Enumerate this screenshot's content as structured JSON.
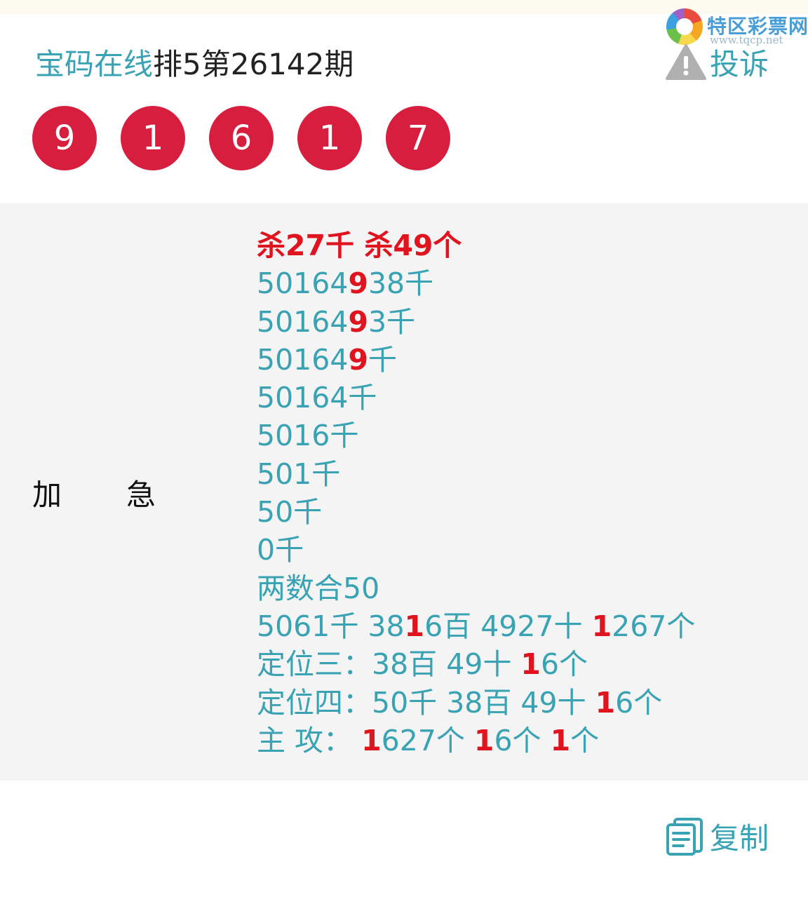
{
  "watermark": {
    "name": "特区彩票网",
    "url": "www.tqcp.net"
  },
  "header": {
    "site_name": "宝码在线",
    "issue_title": "排5第26142期",
    "complaint_label": "投诉"
  },
  "balls": [
    "9",
    "1",
    "6",
    "1",
    "7"
  ],
  "panel": {
    "label_left": "加",
    "label_right": "急",
    "kill_line": "杀27千 杀49个",
    "lines": [
      [
        {
          "t": "50164"
        },
        {
          "t": "9",
          "r": true
        },
        {
          "t": "38千"
        }
      ],
      [
        {
          "t": "50164"
        },
        {
          "t": "9",
          "r": true
        },
        {
          "t": "3千"
        }
      ],
      [
        {
          "t": "50164"
        },
        {
          "t": "9",
          "r": true
        },
        {
          "t": "千"
        }
      ],
      [
        {
          "t": "50164千"
        }
      ],
      [
        {
          "t": "5016千"
        }
      ],
      [
        {
          "t": "501千"
        }
      ],
      [
        {
          "t": "50千"
        }
      ],
      [
        {
          "t": "0千"
        }
      ],
      [
        {
          "t": "两数合50"
        }
      ],
      [
        {
          "t": "5061千 38"
        },
        {
          "t": "1",
          "r": true
        },
        {
          "t": "6百 4927十 "
        },
        {
          "t": "1",
          "r": true
        },
        {
          "t": "267个"
        }
      ],
      [
        {
          "t": "定位三：38百 49十 "
        },
        {
          "t": "1",
          "r": true
        },
        {
          "t": "6个"
        }
      ],
      [
        {
          "t": "定位四：50千 38百 49十 "
        },
        {
          "t": "1",
          "r": true
        },
        {
          "t": "6个"
        }
      ],
      [
        {
          "t": "主 攻：  "
        },
        {
          "t": "1",
          "r": true
        },
        {
          "t": "627个 "
        },
        {
          "t": "1",
          "r": true
        },
        {
          "t": "6个 "
        },
        {
          "t": "1",
          "r": true
        },
        {
          "t": "个"
        }
      ]
    ]
  },
  "footer": {
    "copy_label": "复制"
  },
  "colors": {
    "accent": "#3aa3b3",
    "ball_red": "#d81e3e",
    "highlight_red": "#e0141e",
    "panel_bg": "#f4f4f4"
  }
}
